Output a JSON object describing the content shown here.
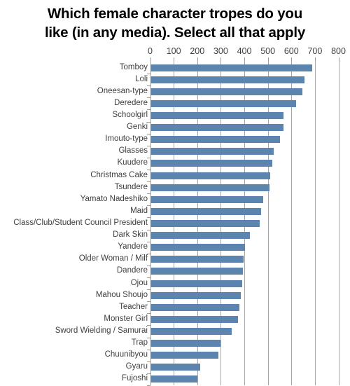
{
  "chart_data": {
    "type": "bar",
    "orientation": "horizontal",
    "title": "Which female character tropes do you\nlike (in any media). Select all that apply",
    "xlabel": "",
    "ylabel": "",
    "xlim": [
      0,
      800
    ],
    "x_ticks": [
      0,
      100,
      200,
      300,
      400,
      500,
      600,
      700,
      800
    ],
    "grid": true,
    "legend": false,
    "bar_color": "#5b84ae",
    "categories": [
      "Tomboy",
      "Loli",
      "Oneesan-type",
      "Deredere",
      "Schoolgirl",
      "Genki",
      "Imouto-type",
      "Glasses",
      "Kuudere",
      "Christmas Cake",
      "Tsundere",
      "Yamato Nadeshiko",
      "Maid",
      "Class/Club/Student Council President",
      "Dark Skin",
      "Yandere",
      "Older Woman / Milf",
      "Dandere",
      "Ojou",
      "Mahou Shoujo",
      "Teacher",
      "Monster Girl",
      "Sword Wielding / Samurai",
      "Trap",
      "Chuunibyou",
      "Gyaru",
      "Fujoshi"
    ],
    "values": [
      687,
      657,
      648,
      621,
      568,
      566,
      551,
      526,
      520,
      510,
      508,
      480,
      472,
      465,
      424,
      402,
      396,
      394,
      392,
      384,
      380,
      372,
      345,
      298,
      290,
      213,
      200
    ]
  }
}
